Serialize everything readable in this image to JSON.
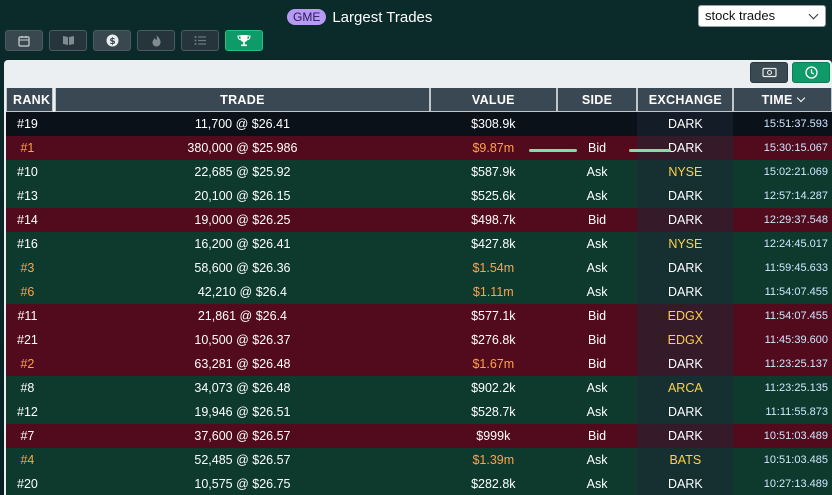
{
  "header": {
    "ticker": "GME",
    "title": "Largest Trades",
    "dropdown_value": "stock trades"
  },
  "tabs": [
    {
      "icon": "calendar-icon",
      "active": false
    },
    {
      "icon": "book-icon",
      "active": false
    },
    {
      "icon": "dollar-icon",
      "active": false
    },
    {
      "icon": "flame-icon",
      "active": false
    },
    {
      "icon": "list-icon",
      "active": false
    },
    {
      "icon": "trophy-icon",
      "active": true
    }
  ],
  "panel_tools": [
    {
      "icon": "money-icon",
      "active": false
    },
    {
      "icon": "clock-icon",
      "active": true
    }
  ],
  "columns": [
    "RANK",
    "TRADE",
    "VALUE",
    "SIDE",
    "EXCHANGE",
    "TIME"
  ],
  "rows": [
    {
      "rank": "#19",
      "trade": "11,700 @ $26.41",
      "value": "$308.9k",
      "side": "",
      "exchange": "DARK",
      "time": "15:51:37.593",
      "kind": "neutral",
      "top": false
    },
    {
      "rank": "#1",
      "trade": "380,000 @ $25.986",
      "value": "$9.87m",
      "side": "Bid",
      "exchange": "DARK",
      "time": "15:30:15.067",
      "kind": "bid",
      "top": true
    },
    {
      "rank": "#10",
      "trade": "22,685 @ $25.92",
      "value": "$587.9k",
      "side": "Ask",
      "exchange": "NYSE",
      "time": "15:02:21.069",
      "kind": "ask",
      "top": false
    },
    {
      "rank": "#13",
      "trade": "20,100 @ $26.15",
      "value": "$525.6k",
      "side": "Ask",
      "exchange": "DARK",
      "time": "12:57:14.287",
      "kind": "ask",
      "top": false
    },
    {
      "rank": "#14",
      "trade": "19,000 @ $26.25",
      "value": "$498.7k",
      "side": "Bid",
      "exchange": "DARK",
      "time": "12:29:37.548",
      "kind": "bid",
      "top": false
    },
    {
      "rank": "#16",
      "trade": "16,200 @ $26.41",
      "value": "$427.8k",
      "side": "Ask",
      "exchange": "NYSE",
      "time": "12:24:45.017",
      "kind": "ask",
      "top": false
    },
    {
      "rank": "#3",
      "trade": "58,600 @ $26.36",
      "value": "$1.54m",
      "side": "Ask",
      "exchange": "DARK",
      "time": "11:59:45.633",
      "kind": "ask",
      "top": true
    },
    {
      "rank": "#6",
      "trade": "42,210 @ $26.4",
      "value": "$1.11m",
      "side": "Ask",
      "exchange": "DARK",
      "time": "11:54:07.455",
      "kind": "ask",
      "top": true
    },
    {
      "rank": "#11",
      "trade": "21,861 @ $26.4",
      "value": "$577.1k",
      "side": "Bid",
      "exchange": "EDGX",
      "time": "11:54:07.455",
      "kind": "bid",
      "top": false
    },
    {
      "rank": "#21",
      "trade": "10,500 @ $26.37",
      "value": "$276.8k",
      "side": "Bid",
      "exchange": "EDGX",
      "time": "11:45:39.600",
      "kind": "bid",
      "top": false
    },
    {
      "rank": "#2",
      "trade": "63,281 @ $26.48",
      "value": "$1.67m",
      "side": "Bid",
      "exchange": "DARK",
      "time": "11:23:25.137",
      "kind": "bid",
      "top": true
    },
    {
      "rank": "#8",
      "trade": "34,073 @ $26.48",
      "value": "$902.2k",
      "side": "Ask",
      "exchange": "ARCA",
      "time": "11:23:25.135",
      "kind": "ask",
      "top": false
    },
    {
      "rank": "#12",
      "trade": "19,946 @ $26.51",
      "value": "$528.7k",
      "side": "Ask",
      "exchange": "DARK",
      "time": "11:11:55.873",
      "kind": "ask",
      "top": false
    },
    {
      "rank": "#7",
      "trade": "37,600 @ $26.57",
      "value": "$999k",
      "side": "Bid",
      "exchange": "DARK",
      "time": "10:51:03.489",
      "kind": "bid",
      "top": false
    },
    {
      "rank": "#4",
      "trade": "52,485 @ $26.57",
      "value": "$1.39m",
      "side": "Ask",
      "exchange": "BATS",
      "time": "10:51:03.485",
      "kind": "ask",
      "top": true
    },
    {
      "rank": "#20",
      "trade": "10,575 @ $26.75",
      "value": "$282.8k",
      "side": "Ask",
      "exchange": "DARK",
      "time": "10:27:13.489",
      "kind": "ask",
      "top": false
    }
  ],
  "colors": {
    "bid_row": "#520b1c",
    "ask_row": "#0e3a2e",
    "top_rank": "#ffa24a",
    "lit_exchange": "#ffd24a",
    "accent": "#0f9a6a"
  }
}
